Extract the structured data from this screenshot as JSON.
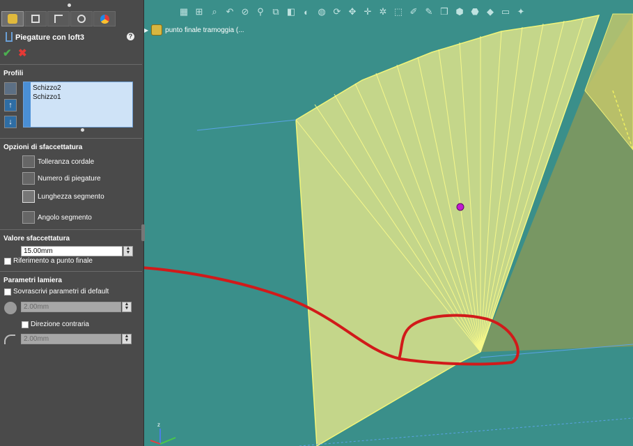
{
  "panel": {
    "feature_title": "Piegature con loft3",
    "help": "?",
    "ok": "✔",
    "cancel": "✖",
    "profiles_title": "Profili",
    "profiles": [
      "Schizzo2",
      "Schizzo1"
    ],
    "move_up": "↑",
    "move_down": "↓",
    "faceting_options_title": "Opzioni di sfaccettatura",
    "faceting_options": [
      "Tolleranza cordale",
      "Numero di piegature",
      "Lunghezza segmento",
      "Angolo segmento"
    ],
    "faceting_value_title": "Valore sfaccettatura",
    "faceting_value": "15.00mm",
    "endpoint_reference": "Riferimento a punto finale",
    "sheet_params_title": "Parametri lamiera",
    "override_defaults": "Sovrascrivi parametri di default",
    "thickness": "2.00mm",
    "reverse_direction": "Direzione contraria",
    "bend_radius": "2.00mm"
  },
  "viewport": {
    "tree_node": "punto finale tramoggia  (..."
  },
  "colors": {
    "panel_bg": "#4a4a4a",
    "viewport_bg": "#3a8f8a",
    "part_fill": "#e3e58a",
    "annotation": "#d11a1a",
    "point": "#c01ad0"
  }
}
